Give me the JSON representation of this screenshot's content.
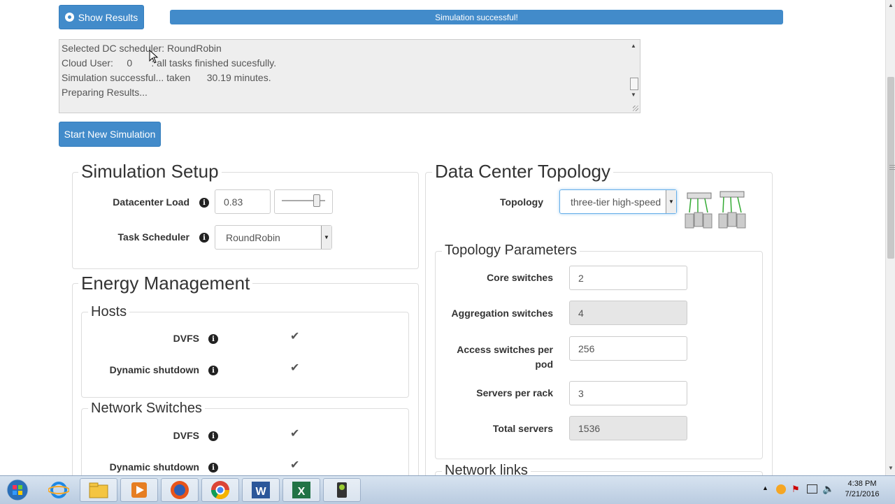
{
  "toolbar": {
    "show_results_label": "Show Results",
    "progress_text": "Simulation successful!",
    "progress_fraction": 1.0
  },
  "log": {
    "lines": [
      "Selected DC scheduler: RoundRobin",
      "Cloud User:     0       : all tasks finished sucesfully.",
      "Simulation successful... taken      30.19 minutes.",
      "Preparing Results..."
    ]
  },
  "start_new_label": "Start New Simulation",
  "simulation_setup": {
    "title": "Simulation Setup",
    "datacenter_load_label": "Datacenter Load",
    "datacenter_load_value": "0.83",
    "datacenter_load_slider": 0.83,
    "task_scheduler_label": "Task Scheduler",
    "task_scheduler_value": "RoundRobin"
  },
  "energy_management": {
    "title": "Energy Management",
    "hosts": {
      "title": "Hosts",
      "dvfs_label": "DVFS",
      "dvfs_checked": true,
      "shutdown_label": "Dynamic shutdown",
      "shutdown_checked": true
    },
    "network_switches": {
      "title": "Network Switches",
      "dvfs_label": "DVFS",
      "dvfs_checked": true,
      "shutdown_label": "Dynamic shutdown",
      "shutdown_checked": true
    }
  },
  "topology": {
    "title": "Data Center Topology",
    "topology_label": "Topology",
    "topology_value": "three-tier high-speed",
    "params": {
      "title": "Topology Parameters",
      "core_label": "Core switches",
      "core_value": "2",
      "aggregation_label": "Aggregation switches",
      "aggregation_value": "4",
      "access_label_1": "Access switches per",
      "access_label_2": "pod",
      "access_value": "256",
      "servers_label": "Servers per rack",
      "servers_value": "3",
      "total_label": "Total servers",
      "total_value": "1536"
    },
    "network_links_title": "Network links"
  },
  "taskbar": {
    "time": "4:38 PM",
    "date": "7/21/2016",
    "apps": [
      "start-orb-icon",
      "internet-explorer-icon",
      "file-explorer-icon",
      "media-player-icon",
      "firefox-icon",
      "chrome-icon",
      "word-icon",
      "excel-icon",
      "camera-app-icon"
    ]
  },
  "colors": {
    "accent": "#428bca",
    "taskbar": "#c4d4e8"
  }
}
